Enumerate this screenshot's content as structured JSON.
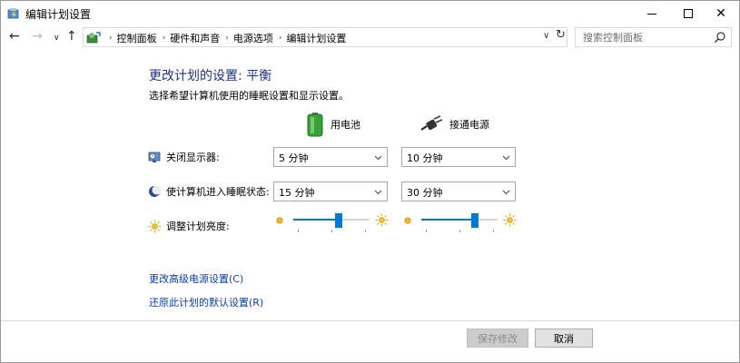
{
  "window": {
    "title": "编辑计划设置",
    "controls": {
      "minimize": "minimize",
      "maximize": "maximize",
      "close": "✕"
    }
  },
  "address_bar": {
    "breadcrumbs": [
      "控制面板",
      "硬件和声音",
      "电源选项",
      "编辑计划设置"
    ],
    "search_placeholder": "搜索控制面板"
  },
  "main": {
    "heading": "更改计划的设置: 平衡",
    "subtitle": "选择希望计算机使用的睡眠设置和显示设置。",
    "columns": {
      "battery": "用电池",
      "plugged_in": "接通电源"
    },
    "settings": {
      "display_off": {
        "label": "关闭显示器:",
        "battery": "5 分钟",
        "plugged_in": "10 分钟"
      },
      "sleep": {
        "label": "使计算机进入睡眠状态:",
        "battery": "15 分钟",
        "plugged_in": "30 分钟"
      },
      "brightness": {
        "label": "调整计划亮度:",
        "battery_percent": 60,
        "plugged_in_percent": 70
      }
    },
    "links": {
      "advanced": "更改高级电源设置(C)",
      "restore": "还原此计划的默认设置(R)"
    }
  },
  "footer": {
    "save_label": "保存修改",
    "cancel_label": "取消"
  },
  "colors": {
    "accent": "#0078d7",
    "heading": "#1e3287",
    "link": "#0a3ea8"
  }
}
